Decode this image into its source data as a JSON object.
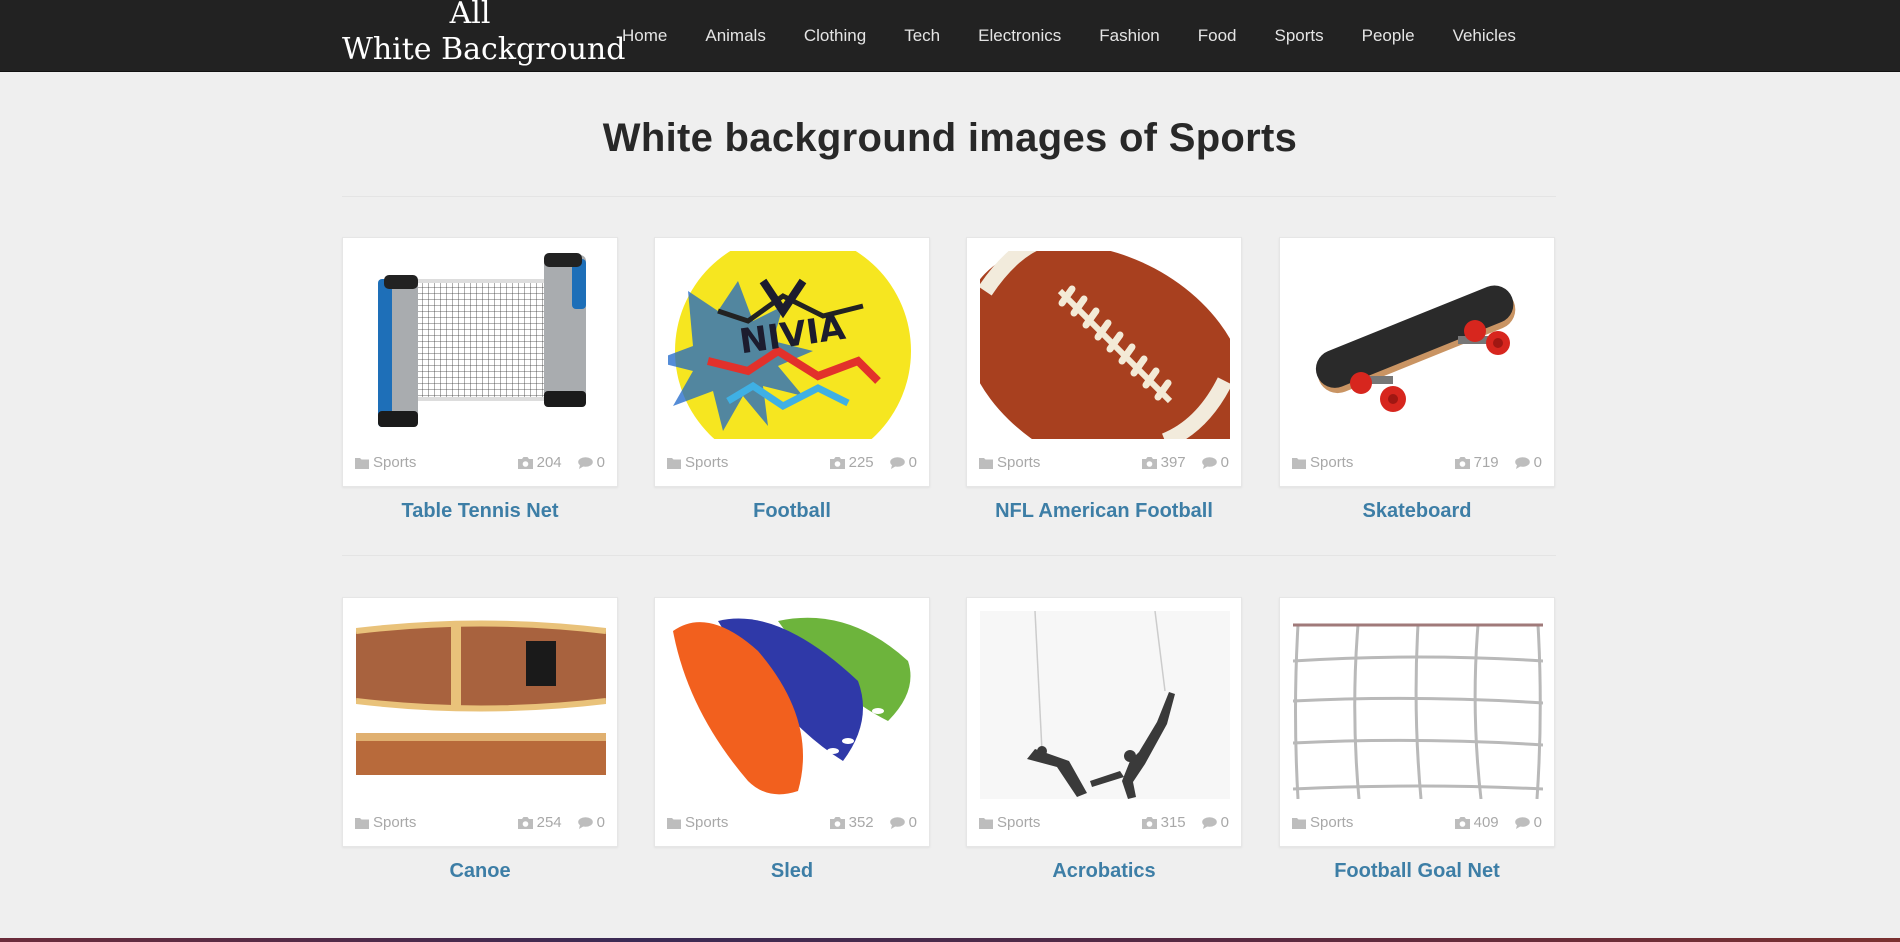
{
  "site": {
    "logo_line1": "All",
    "logo_line2": "White Background"
  },
  "nav": {
    "items": [
      "Home",
      "Animals",
      "Clothing",
      "Tech",
      "Electronics",
      "Fashion",
      "Food",
      "Sports",
      "People",
      "Vehicles"
    ]
  },
  "page": {
    "title": "White background images of Sports"
  },
  "cards": [
    {
      "title": "Table Tennis Net",
      "category": "Sports",
      "photos": "204",
      "comments": "0"
    },
    {
      "title": "Football",
      "category": "Sports",
      "photos": "225",
      "comments": "0"
    },
    {
      "title": "NFL American Football",
      "category": "Sports",
      "photos": "397",
      "comments": "0"
    },
    {
      "title": "Skateboard",
      "category": "Sports",
      "photos": "719",
      "comments": "0"
    },
    {
      "title": "Canoe",
      "category": "Sports",
      "photos": "254",
      "comments": "0"
    },
    {
      "title": "Sled",
      "category": "Sports",
      "photos": "352",
      "comments": "0"
    },
    {
      "title": "Acrobatics",
      "category": "Sports",
      "photos": "315",
      "comments": "0"
    },
    {
      "title": "Football Goal Net",
      "category": "Sports",
      "photos": "409",
      "comments": "0"
    }
  ],
  "icons": {
    "category": "folder-icon",
    "photos": "camera-icon",
    "comments": "comment-icon"
  },
  "colors": {
    "header_bg": "#222222",
    "page_bg": "#efefef",
    "title_link": "#3d7ea6",
    "meta_text": "#a8a8a8"
  }
}
